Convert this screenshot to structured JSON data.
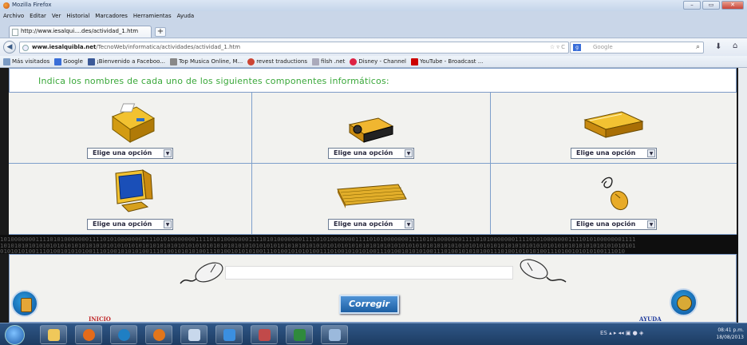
{
  "window": {
    "title": "Mozilla Firefox",
    "min": "–",
    "max": "▭",
    "close": "✕"
  },
  "menu": [
    "Archivo",
    "Editar",
    "Ver",
    "Historial",
    "Marcadores",
    "Herramientas",
    "Ayuda"
  ],
  "tab": {
    "label": "http://www.iesalqui....des/actividad_1.htm",
    "new_tab": "+"
  },
  "nav": {
    "url_domain": "www.iesalquibla.net",
    "url_path": "/TecnoWeb/informatica/actividades/actividad_1.htm",
    "url_controls": "☆ ▿ C",
    "search_placeholder": "Google",
    "search_engine": "g",
    "back": "◀"
  },
  "bookmarks": [
    {
      "label": "Más visitados",
      "color": "#7a9ac4"
    },
    {
      "label": "Google",
      "color": "#3a6ed8"
    },
    {
      "label": "¡Bienvenido a Faceboo...",
      "color": "#3b5998"
    },
    {
      "label": "Top Musica Online, M...",
      "color": "#888888"
    },
    {
      "label": "revest traductions",
      "color": "#c43"
    },
    {
      "label": "filsh .net",
      "color": "#aab"
    },
    {
      "label": "Disney - Channel",
      "color": "#d24"
    },
    {
      "label": "YouTube - Broadcast ...",
      "color": "#c00"
    }
  ],
  "activity": {
    "question": "Indica los nombres de cada uno de los siguientes componentes informáticos:",
    "select_label": "Elige una opción",
    "items": [
      {
        "icon": "printer-icon"
      },
      {
        "icon": "projector-icon"
      },
      {
        "icon": "scanner-icon"
      },
      {
        "icon": "monitor-icon"
      },
      {
        "icon": "keyboard-icon"
      },
      {
        "icon": "mouse-icon"
      }
    ],
    "binary_row1": "10100000001111010100000001111010100000001111010100000001111010100000001111010100000001111010100000001111010100000001111010100000001111010100000001111010100000001111010100000001111",
    "binary_row2": "10101010101010101010101010101010101010101010101010101010101010101010101010101010101010101010101010101010101010101010101010101010101010101010101010101010101010101010101010101010101",
    "binary_row3": "01010101001110100101010100111010010101010011101001010101001110100101010100111010010101010011101001010101001110100101010100111010010101010011101001010101001110100101010100111010",
    "corregir": "Corregir",
    "inicio": "INICIO",
    "ayuda": "AYUDA"
  },
  "taskbar": {
    "lang": "ES",
    "time": "08:41 p.m.",
    "date": "18/08/2013"
  }
}
